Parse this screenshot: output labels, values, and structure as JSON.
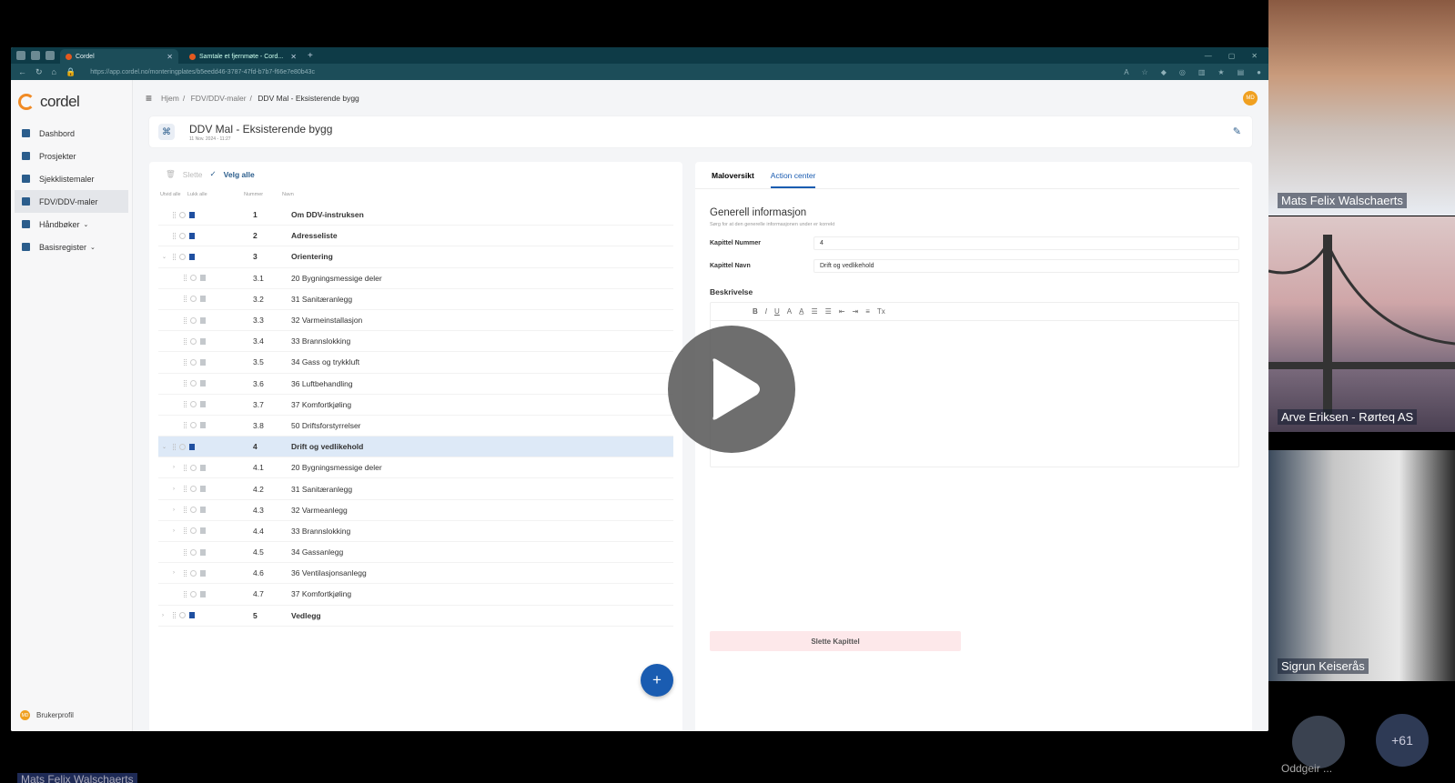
{
  "browser": {
    "tab_active": "Cordel",
    "tab_inactive": "Samtale et fjernmøte - Cord...",
    "url": "https://app.cordel.no/monteringplates/b5eedd46-3787-47fd-b7b7-f66e7e80b43c"
  },
  "app": {
    "logo": "cordel",
    "nav": [
      {
        "label": "Dashbord",
        "icon": "dashboard-icon"
      },
      {
        "label": "Prosjekter",
        "icon": "projects-icon"
      },
      {
        "label": "Sjekklistemaler",
        "icon": "checklist-icon"
      },
      {
        "label": "FDV/DDV-maler",
        "icon": "template-icon"
      },
      {
        "label": "Håndbøker",
        "icon": "book-icon"
      },
      {
        "label": "Basisregister",
        "icon": "register-icon"
      }
    ],
    "profile": "Brukerprofil",
    "avatar_initials": "MD",
    "breadcrumb": [
      "Hjem",
      "FDV/DDV-maler",
      "DDV Mal - Eksisterende bygg"
    ],
    "doc_title": "DDV Mal - Eksisterende bygg",
    "doc_date": "11 Nov. 2024 - 11:27"
  },
  "list": {
    "delete": "Slette",
    "select_all": "Velg alle",
    "col_expand": "Utvid alle",
    "col_collapse": "Lukk alle",
    "col_number": "Nummer",
    "col_name": "Navn",
    "rows": [
      {
        "num": "1",
        "name": "Om DDV-instruksen"
      },
      {
        "num": "2",
        "name": "Adresseliste"
      },
      {
        "num": "3",
        "name": "Orientering"
      },
      {
        "num": "3.1",
        "name": "20 Bygningsmessige deler"
      },
      {
        "num": "3.2",
        "name": "31 Sanitæranlegg"
      },
      {
        "num": "3.3",
        "name": "32 Varmeinstallasjon"
      },
      {
        "num": "3.4",
        "name": "33 Brannslokking"
      },
      {
        "num": "3.5",
        "name": "34 Gass og trykkluft"
      },
      {
        "num": "3.6",
        "name": "36 Luftbehandling"
      },
      {
        "num": "3.7",
        "name": "37 Komfortkjøling"
      },
      {
        "num": "3.8",
        "name": "50 Driftsforstyrrelser"
      },
      {
        "num": "4",
        "name": "Drift og vedlikehold"
      },
      {
        "num": "4.1",
        "name": "20 Bygningsmessige deler"
      },
      {
        "num": "4.2",
        "name": "31 Sanitæranlegg"
      },
      {
        "num": "4.3",
        "name": "32 Varmeanlegg"
      },
      {
        "num": "4.4",
        "name": "33 Brannslokking"
      },
      {
        "num": "4.5",
        "name": "34 Gassanlegg"
      },
      {
        "num": "4.6",
        "name": "36 Ventilasjonsanlegg"
      },
      {
        "num": "4.7",
        "name": "37 Komfortkjøling"
      },
      {
        "num": "5",
        "name": "Vedlegg"
      }
    ]
  },
  "detail": {
    "tabs": [
      "Maloversikt",
      "Action center"
    ],
    "heading": "Generell informasjon",
    "subheading": "Sørg for at den generelle informasjonen under er korrekt",
    "chapter_number_label": "Kapittel Nummer",
    "chapter_number": "4",
    "chapter_name_label": "Kapittel Navn",
    "chapter_name": "Drift og vedlikehold",
    "description_label": "Beskrivelse",
    "delete_chapter": "Slette Kapittel"
  },
  "call": {
    "participants": [
      "Mats Felix Walschaerts",
      "Arve Eriksen - Rørteq AS",
      "Sigrun Keiserås"
    ],
    "small_name": "Oddgeir ...",
    "more_count": "+61",
    "presenter": "Mats Felix Walschaerts"
  }
}
